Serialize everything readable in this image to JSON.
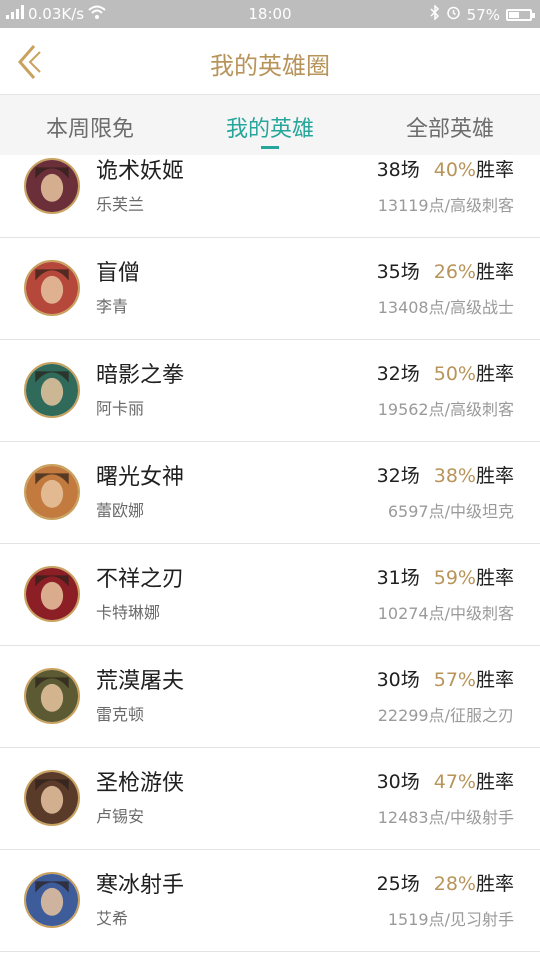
{
  "status_bar": {
    "network_speed": "0.03K/s",
    "time": "18:00",
    "battery": "57%",
    "battery_level": 0.57
  },
  "header": {
    "title": "我的英雄圈"
  },
  "tabs": [
    {
      "label": "本周限免"
    },
    {
      "label": "我的英雄"
    },
    {
      "label": "全部英雄"
    }
  ],
  "win_rate_suffix": "胜率",
  "heroes": [
    {
      "title": "诡术妖姬",
      "name": "乐芙兰",
      "games": "38场",
      "win_pct": "40%",
      "points": "13119点/高级刺客",
      "avatar_color": "#6b2f3a"
    },
    {
      "title": "盲僧",
      "name": "李青",
      "games": "35场",
      "win_pct": "26%",
      "points": "13408点/高级战士",
      "avatar_color": "#b5483a"
    },
    {
      "title": "暗影之拳",
      "name": "阿卡丽",
      "games": "32场",
      "win_pct": "50%",
      "points": "19562点/高级刺客",
      "avatar_color": "#2f6a5a"
    },
    {
      "title": "曙光女神",
      "name": "蕾欧娜",
      "games": "32场",
      "win_pct": "38%",
      "points": "6597点/中级坦克",
      "avatar_color": "#c27a3e"
    },
    {
      "title": "不祥之刃",
      "name": "卡特琳娜",
      "games": "31场",
      "win_pct": "59%",
      "points": "10274点/中级刺客",
      "avatar_color": "#8c1f26"
    },
    {
      "title": "荒漠屠夫",
      "name": "雷克顿",
      "games": "30场",
      "win_pct": "57%",
      "points": "22299点/征服之刃",
      "avatar_color": "#5b5a32"
    },
    {
      "title": "圣枪游侠",
      "name": "卢锡安",
      "games": "30场",
      "win_pct": "47%",
      "points": "12483点/中级射手",
      "avatar_color": "#5a3b2a"
    },
    {
      "title": "寒冰射手",
      "name": "艾希",
      "games": "25场",
      "win_pct": "28%",
      "points": "1519点/见习射手",
      "avatar_color": "#3e5b9a"
    }
  ]
}
